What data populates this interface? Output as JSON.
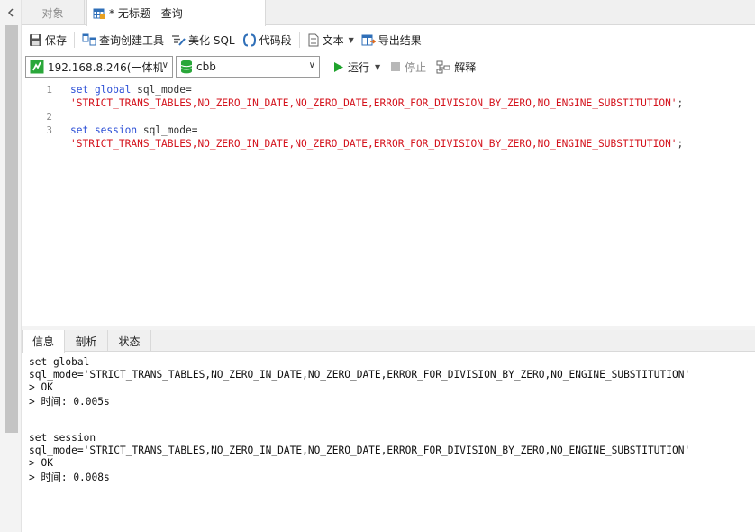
{
  "tabs": {
    "objects": "对象",
    "query": "* 无标题 - 查询"
  },
  "toolbar": {
    "save": "保存",
    "query_builder": "查询创建工具",
    "beautify_sql": "美化 SQL",
    "code_snippet": "代码段",
    "text": "文本",
    "export_results": "导出结果"
  },
  "toolbar2": {
    "connection": "192.168.8.246(一体机",
    "database": "cbb",
    "run": "运行",
    "stop": "停止",
    "explain": "解释"
  },
  "editor": {
    "line_numbers": [
      "1",
      "2",
      "3"
    ],
    "lines": [
      {
        "kw": "set global",
        "rest": " sql_mode="
      },
      {
        "str": "'STRICT_TRANS_TABLES,NO_ZERO_IN_DATE,NO_ZERO_DATE,ERROR_FOR_DIVISION_BY_ZERO,NO_ENGINE_SUBSTITUTION'",
        "end": ";"
      },
      {
        "kw": "set session",
        "rest": " sql_mode="
      },
      {
        "str": "'STRICT_TRANS_TABLES,NO_ZERO_IN_DATE,NO_ZERO_DATE,ERROR_FOR_DIVISION_BY_ZERO,NO_ENGINE_SUBSTITUTION'",
        "end": ";"
      }
    ]
  },
  "result_tabs": {
    "info": "信息",
    "profile": "剖析",
    "status": "状态"
  },
  "output": [
    "set global",
    "sql_mode='STRICT_TRANS_TABLES,NO_ZERO_IN_DATE,NO_ZERO_DATE,ERROR_FOR_DIVISION_BY_ZERO,NO_ENGINE_SUBSTITUTION'",
    "> OK",
    "> 时间: 0.005s",
    "set session",
    "sql_mode='STRICT_TRANS_TABLES,NO_ZERO_IN_DATE,NO_ZERO_DATE,ERROR_FOR_DIVISION_BY_ZERO,NO_ENGINE_SUBSTITUTION'",
    "> OK",
    "> 时间: 0.008s"
  ],
  "colors": {
    "keyword": "#2c4fd6",
    "string": "#d4131d",
    "run_green": "#1fa32d"
  }
}
